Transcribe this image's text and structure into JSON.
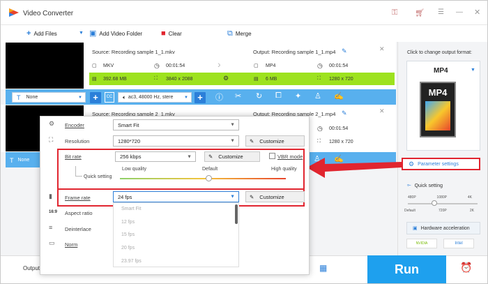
{
  "app": {
    "title": "Video Converter"
  },
  "toolbar": {
    "add_files": "Add Files",
    "add_video_folder": "Add Video Folder",
    "clear": "Clear",
    "merge": "Merge"
  },
  "files": [
    {
      "source": "Source: Recording sample 1_1.mkv",
      "src_format": "MKV",
      "src_duration": "00:01:54",
      "src_size": "392.68 MB",
      "src_resolution": "3840 x 2088",
      "output": "Output: Recording sample 1_1.mp4",
      "out_format": "MP4",
      "out_duration": "00:01:54",
      "out_size": "6 MB",
      "out_resolution": "1280 x 720"
    },
    {
      "source": "Source: Recording sample 2_1.mkv",
      "output": "Output: Recording sample 2_1.mp4",
      "out_duration": "00:01:54",
      "out_resolution": "1280 x 720"
    }
  ],
  "edit_bar": {
    "subtitle": "None",
    "audio": "ac3, 48000 Hz, stere",
    "subtitle2": "None"
  },
  "right_panel": {
    "hint": "Click to change output format:",
    "format": "MP4",
    "format_icon_text": "MP4",
    "parameter_settings": "Parameter settings",
    "quick_setting": "Quick setting",
    "ticks_top": [
      "480P",
      "1080P",
      "4K"
    ],
    "ticks_bottom": [
      "Default",
      "720P",
      "2K"
    ],
    "hw_accel": "Hardware acceleration",
    "nvidia": "NVIDIA",
    "intel": "Intel"
  },
  "bottom": {
    "output_label": "Output",
    "run": "Run"
  },
  "dialog": {
    "encoder_label": "Encoder",
    "encoder_value": "Smart Fit",
    "resolution_label": "Resolution",
    "resolution_value": "1280*720",
    "customize": "Customize",
    "bitrate_label": "Bit rate",
    "bitrate_value": "256 kbps",
    "vbr_mode": "VBR mode",
    "quick_setting": "Quick setting",
    "low_quality": "Low quality",
    "default": "Default",
    "high_quality": "High quality",
    "framerate_label": "Frame rate",
    "framerate_value": "24 fps",
    "aspect_label": "Aspect ratio",
    "deinterlace_label": "Deinterlace",
    "norm_label": "Norm",
    "fps_options": [
      "Smart Fit",
      "12 fps",
      "15 fps",
      "20 fps",
      "23.97 fps"
    ]
  },
  "colors": {
    "accent_blue": "#1ea0ee",
    "highlight_red": "#e1252f",
    "green_bar": "#9de21e"
  }
}
